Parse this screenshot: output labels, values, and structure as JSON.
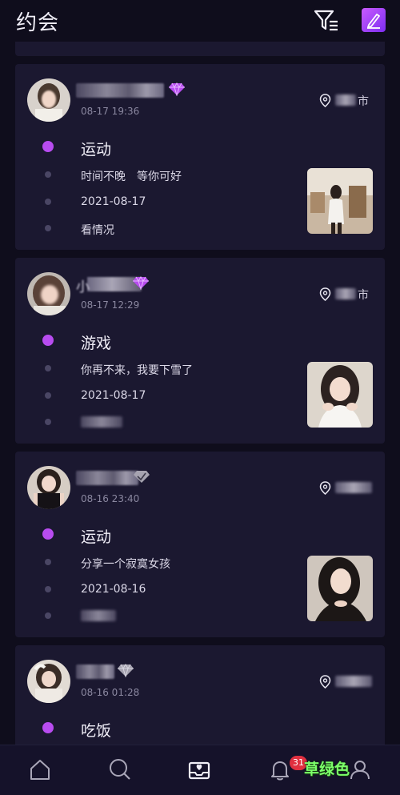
{
  "header": {
    "title": "约会",
    "filter_icon": "filter-list-icon",
    "edit_icon": "edit-pencil-icon",
    "accent_color": "#b84cf0"
  },
  "posts": [
    {
      "name_prefix": "",
      "badge": "purple-diamond",
      "time": "08-17 19:36",
      "location_suffix": "市",
      "activity": "运动",
      "message": "时间不晚　等你可好",
      "date": "2021-08-17",
      "note": "看情况"
    },
    {
      "name_prefix": "小",
      "badge": "purple-diamond",
      "time": "08-17 12:29",
      "location_suffix": "市",
      "activity": "游戏",
      "message": "你再不来，我要下雪了",
      "date": "2021-08-17",
      "note": ""
    },
    {
      "name_prefix": "",
      "badge": "grey-diamond",
      "time": "08-16 23:40",
      "location_suffix": "",
      "activity": "运动",
      "message": "分享一个寂寞女孩",
      "date": "2021-08-16",
      "note": ""
    },
    {
      "name_prefix": "",
      "badge": "grey-diamond",
      "time": "08-16 01:28",
      "location_suffix": "",
      "activity": "吃饭"
    }
  ],
  "bottom_nav": {
    "items": [
      "home-icon",
      "search-icon",
      "date-inbox-icon",
      "bell-icon",
      "profile-icon"
    ],
    "notification_count": "31"
  },
  "watermark": "草绿色"
}
